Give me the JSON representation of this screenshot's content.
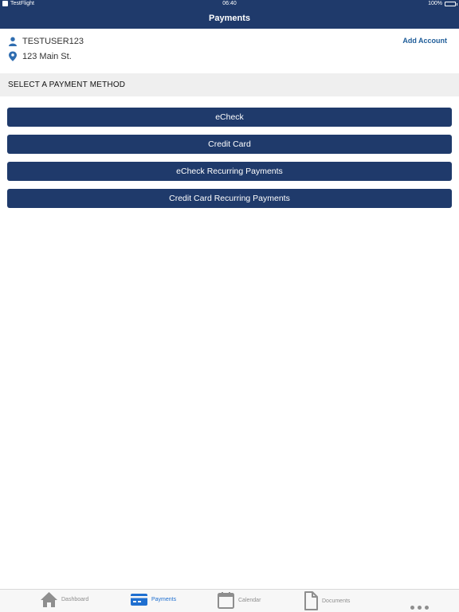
{
  "status_bar": {
    "app": "TestFlight",
    "time": "06:40",
    "battery": "100%"
  },
  "nav": {
    "title": "Payments"
  },
  "account": {
    "username": "TESTUSER123",
    "address": "123 Main St.",
    "add_account_label": "Add Account"
  },
  "section": {
    "header": "SELECT A PAYMENT METHOD"
  },
  "payment_methods": [
    {
      "label": "eCheck"
    },
    {
      "label": "Credit Card"
    },
    {
      "label": "eCheck Recurring Payments"
    },
    {
      "label": "Credit Card Recurring Payments"
    }
  ],
  "tabs": [
    {
      "label": "Dashboard",
      "icon": "house-icon",
      "active": false
    },
    {
      "label": "Payments",
      "icon": "credit-card-icon",
      "active": true
    },
    {
      "label": "Calendar",
      "icon": "calendar-icon",
      "active": false
    },
    {
      "label": "Documents",
      "icon": "document-icon",
      "active": false
    }
  ],
  "colors": {
    "primary": "#1f3a6b",
    "accent_link": "#1f5d99",
    "active_tab": "#1f6fd0",
    "inactive_tab": "#8e8e8e",
    "section_bg": "#efefef"
  }
}
